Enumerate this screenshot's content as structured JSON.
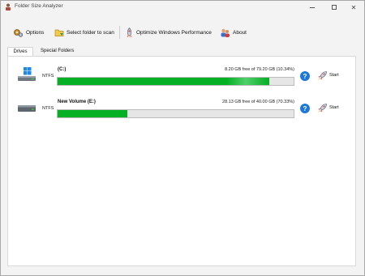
{
  "window": {
    "title": "Folder Size Analyzer"
  },
  "toolbar": {
    "options_label": "Options",
    "select_folder_label": "Select folder to scan",
    "optimize_label": "Optimize Windows Performance",
    "about_label": "About"
  },
  "tabs": [
    {
      "label": "Drives",
      "active": true
    },
    {
      "label": "Special Folders",
      "active": false
    }
  ],
  "drives": [
    {
      "name": "(C:)",
      "filesystem": "NTFS",
      "free_text": "8.20 GB free of 79.20 GB (10.34%)",
      "used_fraction": 0.8966,
      "start_label": "Start",
      "bar_color": "#06b025",
      "icon": "windows-drive-icon"
    },
    {
      "name": "New Volume (E:)",
      "filesystem": "NTFS",
      "free_text": "28.13 GB free of 40.00 GB (70.33%)",
      "used_fraction": 0.2967,
      "start_label": "Start",
      "bar_color": "#06b025",
      "icon": "hard-drive-icon"
    }
  ],
  "icons": {
    "help": "help-icon",
    "start": "rocket-icon"
  },
  "colors": {
    "accent_blue": "#1e78d7",
    "progress_green": "#06b025"
  }
}
